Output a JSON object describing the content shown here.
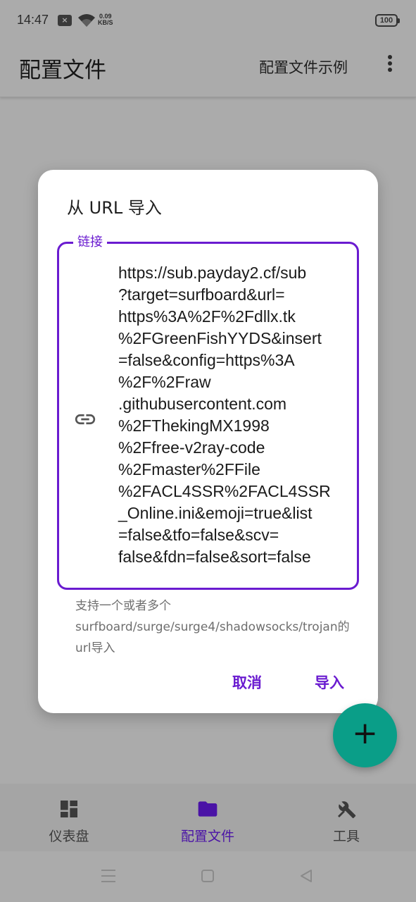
{
  "status_bar": {
    "time": "14:47",
    "speed_value": "0.09",
    "speed_unit": "KB/S",
    "battery": "100"
  },
  "app_bar": {
    "title": "配置文件",
    "action_label": "配置文件示例",
    "overflow_icon": "more-vert-icon"
  },
  "dialog": {
    "title": "从 URL 导入",
    "field_label": "链接",
    "field_icon": "link-icon",
    "url_value": "https://sub.payday2.cf/sub\n?target=surfboard&url=\nhttps%3A%2F%2Fdllx.tk\n%2FGreenFishYYDS&insert\n=false&config=https%3A\n%2F%2Fraw\n.githubusercontent.com\n%2FThekingMX1998\n%2Ffree-v2ray-code\n%2Fmaster%2FFile\n%2FACL4SSR%2FACL4SSR\n_Online.ini&emoji=true&list\n=false&tfo=false&scv=\nfalse&fdn=false&sort=false",
    "helper_text": "支持一个或者多个surfboard/surge/surge4/shadowsocks/trojan的url导入",
    "cancel_label": "取消",
    "import_label": "导入",
    "accent_color": "#6a1bd0"
  },
  "fab": {
    "label": "+",
    "icon": "add-icon",
    "color": "#0a9e88"
  },
  "bottom_nav": {
    "items": [
      {
        "label": "仪表盘",
        "icon": "dashboard-icon",
        "active": false
      },
      {
        "label": "配置文件",
        "icon": "folder-icon",
        "active": true
      },
      {
        "label": "工具",
        "icon": "tools-icon",
        "active": false
      }
    ]
  }
}
